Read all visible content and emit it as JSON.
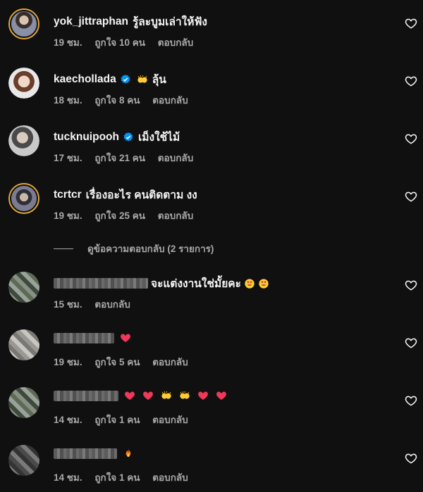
{
  "comments": [
    {
      "username": "yok_jittraphan",
      "text": "รู้ละบูมเล่าให้ฟัง",
      "time": "19 ชม.",
      "likes": "ถูกใจ 10 คน",
      "reply": "ตอบกลับ"
    },
    {
      "username": "kaechollada",
      "text": "ลุ้น",
      "time": "18 ชม.",
      "likes": "ถูกใจ 8 คน",
      "reply": "ตอบกลับ"
    },
    {
      "username": "tucknuipooh",
      "text": "เม็งใช้ไม้",
      "time": "17 ชม.",
      "likes": "ถูกใจ 21 คน",
      "reply": "ตอบกลับ"
    },
    {
      "username": "tcrtcr",
      "text": "เรื่องอะไร คนติดตาม งง",
      "time": "19 ชม.",
      "likes": "ถูกใจ 25 คน",
      "reply": "ตอบกลับ"
    },
    {
      "text": "จะแต่งงานใช่มั้ยคะ",
      "time": "15 ชม.",
      "reply": "ตอบกลับ"
    },
    {
      "time": "19 ชม.",
      "likes": "ถูกใจ 5 คน",
      "reply": "ตอบกลับ"
    },
    {
      "time": "14 ชม.",
      "likes": "ถูกใจ 1 คน",
      "reply": "ตอบกลับ"
    },
    {
      "time": "14 ชม.",
      "likes": "ถูกใจ 1 คน",
      "reply": "ตอบกลับ"
    }
  ],
  "view_replies": "ดูข้อความตอบกลับ (2 รายการ)",
  "icons": {
    "like": "heart-outline-icon",
    "verified": "verified-badge-icon"
  },
  "colors": {
    "background": "#101010",
    "secondary_text": "#a8a8a8",
    "verified": "#0095f6",
    "story_ring": "#e1a73a"
  }
}
